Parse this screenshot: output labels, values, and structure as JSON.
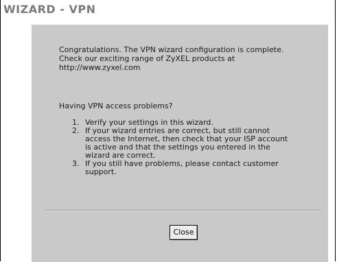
{
  "window": {
    "title": "WIZARD - VPN"
  },
  "message": {
    "lines": [
      "Congratulations. The VPN wizard configuration is complete.",
      "Check our exciting range of ZyXEL products at http://www.zyxel.com"
    ]
  },
  "help": {
    "question": "Having VPN access problems?",
    "steps": [
      {
        "number": "1.",
        "text": "Verify your settings in this wizard."
      },
      {
        "number": "2.",
        "text": "If your wizard entries are correct, but still cannot access the Internet, then check that your ISP account is active and that the settings you entered in the wizard are correct."
      },
      {
        "number": "3.",
        "text": "If you still have problems, please contact customer support."
      }
    ]
  },
  "actions": {
    "close_label": "Close"
  },
  "colors": {
    "title": "#7a7a7a",
    "panel": "#c9c9c9",
    "button": "#ececec"
  }
}
